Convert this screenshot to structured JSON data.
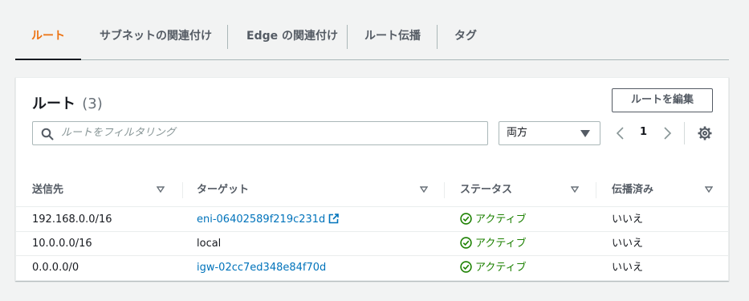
{
  "tabs": [
    {
      "label": "ルート",
      "active": true
    },
    {
      "label": "サブネットの関連付け"
    },
    {
      "label": "Edge の関連付け"
    },
    {
      "label": "ルート伝播"
    },
    {
      "label": "タグ"
    }
  ],
  "panel": {
    "title": "ルート",
    "count": "(3)",
    "edit_button": "ルートを編集",
    "search_placeholder": "ルートをフィルタリング",
    "select_value": "両方",
    "page": "1"
  },
  "table": {
    "columns": [
      "送信先",
      "ターゲット",
      "ステータス",
      "伝播済み"
    ],
    "rows": [
      {
        "destination": "192.168.0.0/16",
        "target": "eni-06402589f219c231d",
        "status": "アクティブ",
        "propagated": "いいえ"
      },
      {
        "destination": "10.0.0.0/16",
        "target": "local",
        "status": "アクティブ",
        "propagated": "いいえ"
      },
      {
        "destination": "0.0.0.0/0",
        "target": "igw-02cc7ed348e84f70d",
        "status": "アクティブ",
        "propagated": "いいえ"
      }
    ]
  },
  "colors": {
    "accent": "#ec7211",
    "link": "#0073bb",
    "success": "#1d8102"
  }
}
